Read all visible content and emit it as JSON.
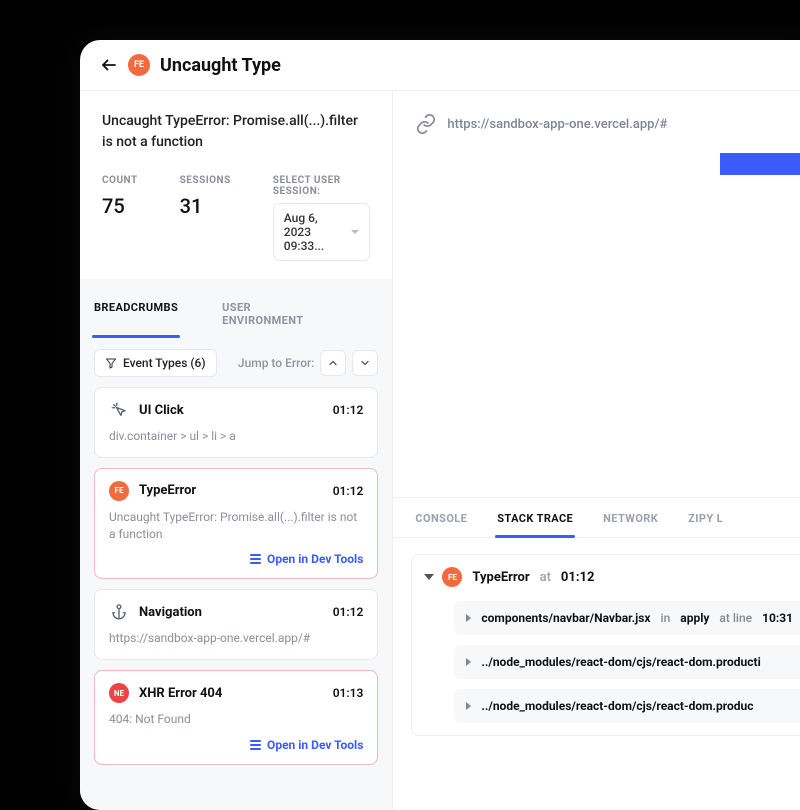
{
  "header": {
    "badge_text": "FE",
    "title": "Uncaught Type"
  },
  "error": {
    "message": "Uncaught TypeError: Promise.all(...).filter is not a function"
  },
  "stats": {
    "count_label": "COUNT",
    "count_value": "75",
    "sessions_label": "SESSIONS",
    "sessions_value": "31",
    "select_label": "SELECT USER SESSION:",
    "selected_session": "Aug 6, 2023 09:33..."
  },
  "left_tabs": {
    "breadcrumbs": "BREADCRUMBS",
    "user_env": "USER ENVIRONMENT"
  },
  "filters": {
    "event_types": "Event Types (6)",
    "jump_label": "Jump to Error:"
  },
  "events": [
    {
      "title": "UI Click",
      "time": "01:12",
      "detail": "div.container > ul > li > a"
    },
    {
      "badge": "FE",
      "title": "TypeError",
      "time": "01:12",
      "detail": "Uncaught TypeError: Promise.all(...).filter is not a function",
      "action": "Open in Dev Tools"
    },
    {
      "title": "Navigation",
      "time": "01:12",
      "detail": "https://sandbox-app-one.vercel.app/#"
    },
    {
      "badge": "NE",
      "title": "XHR Error 404",
      "time": "01:13",
      "detail": "404: Not Found",
      "action": "Open in Dev Tools"
    }
  ],
  "preview": {
    "url": "https://sandbox-app-one.vercel.app/#"
  },
  "right_tabs": {
    "console": "CONSOLE",
    "stack": "STACK TRACE",
    "network": "NETWORK",
    "zipy": "ZIPY L"
  },
  "stack": {
    "badge": "FE",
    "title": "TypeError",
    "at_label": "at",
    "time": "01:12",
    "frames": [
      {
        "path": "components/navbar/Navbar.jsx",
        "in": "in",
        "fn": "apply",
        "at": "at line",
        "line": "10:31"
      },
      {
        "path": "../node_modules/react-dom/cjs/react-dom.producti"
      },
      {
        "path": "../node_modules/react-dom/cjs/react-dom.produc"
      }
    ]
  }
}
